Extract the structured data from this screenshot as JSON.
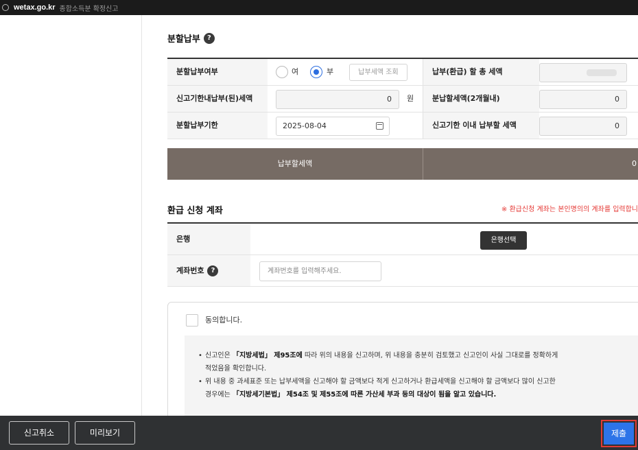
{
  "browser": {
    "domain": "wetax.go.kr",
    "page_title": "종합소득분 확정신고"
  },
  "installment": {
    "title": "분할납부",
    "help_icon": "?",
    "labels": {
      "installment_option": "분할납부여부",
      "paid_within_deadline": "신고기한내납부(된)세액",
      "installment_deadline": "분할납부기한",
      "total_tax_due": "납부(환급) 할 총 세액",
      "installment_amount": "분납할세액(2개월내)",
      "pay_within_deadline": "신고기한 이내 납부할 세액"
    },
    "radio_yes": "여",
    "radio_no": "부",
    "selected": "부",
    "lookup_button": "납부세액 조회",
    "paid_within_deadline_value": "0",
    "unit": "원",
    "deadline_value": "2025-08-04",
    "installment_amount_value": "0",
    "pay_within_deadline_value": "0",
    "payable_label": "납부할세액",
    "payable_value": "0"
  },
  "refund": {
    "title": "환급 신청 계좌",
    "notice": "※ 환급신청 계좌는 본인명의의 계좌를 입력합니",
    "bank_label": "은행",
    "bank_button": "은행선택",
    "account_label": "계좌번호",
    "account_placeholder": "계좌번호를 입력해주세요."
  },
  "consent": {
    "checkbox_label": "동의합니다.",
    "item1": {
      "pre": "신고인은 ",
      "bold": "「지방세법」 제95조에",
      "post": " 따라 위의 내용을 신고하며, 위 내용을 충분히 검토했고 신고인이 사실 그대로를 정확하게",
      "line2": "적었음을 확인합니다."
    },
    "item2": {
      "line1": "위 내용 중 과세표준 또는 납부세액을 신고해야 할 금액보다 적게 신고하거나 환급세액을 신고해야 할 금액보다 많이 신고한",
      "pre2": "경우에는 ",
      "bold2": "「지방세기본법」 제54조 및 제55조에 따른 가산세 부과 등의 대상이 됨을 알고 있습니다."
    }
  },
  "footer": {
    "cancel": "신고취소",
    "preview": "미리보기",
    "submit": "제출"
  }
}
